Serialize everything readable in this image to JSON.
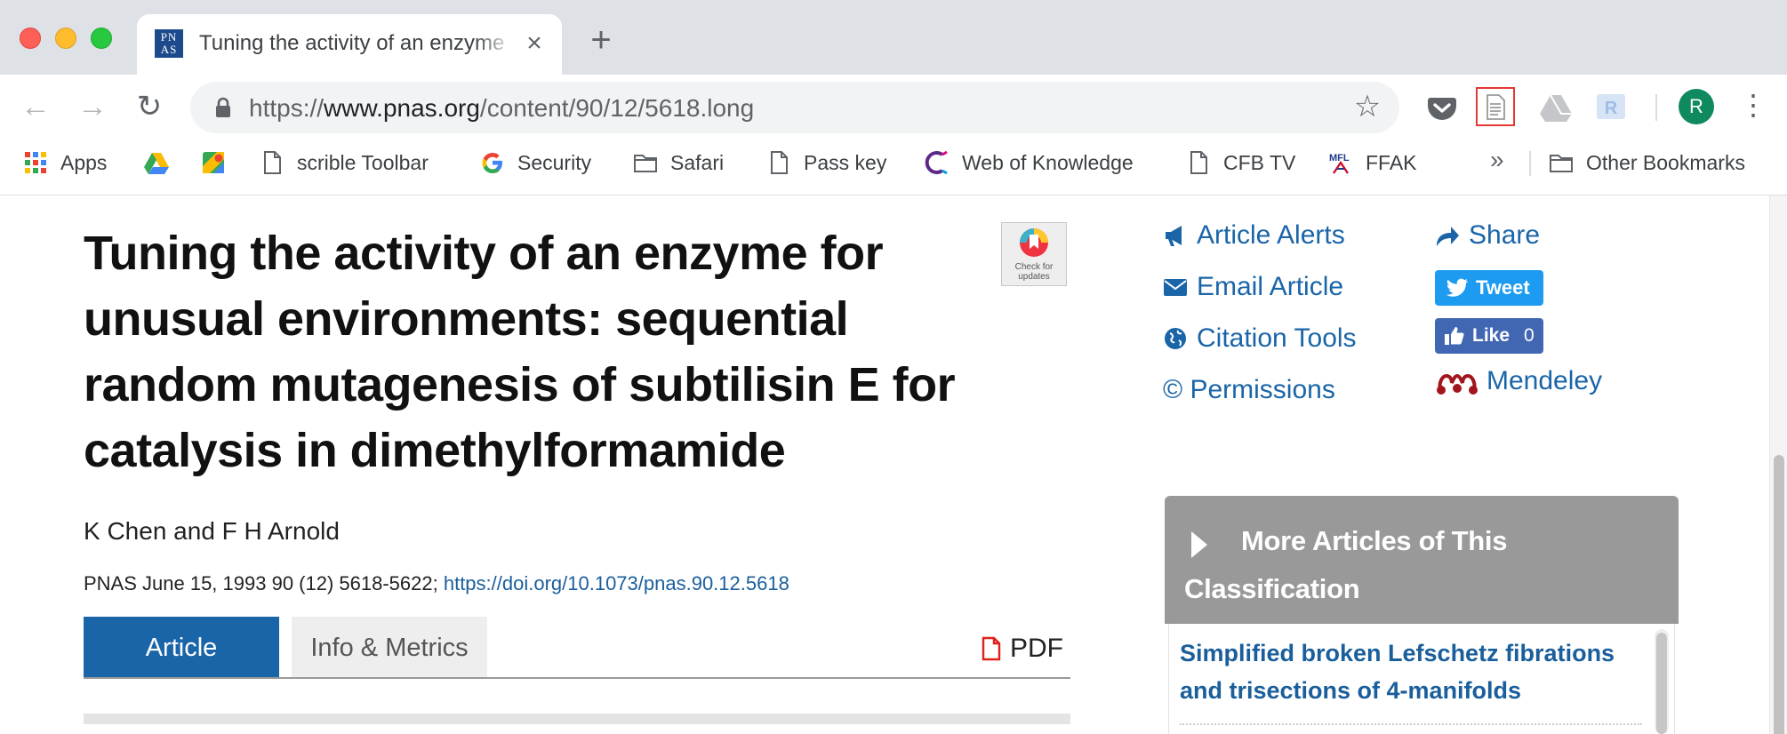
{
  "browser": {
    "tab": {
      "favicon_text": "PN AS",
      "title": "Tuning the activity of an enzyme for unusual environments"
    },
    "url": {
      "scheme": "https://",
      "host": "www.pnas.org",
      "path": "/content/90/12/5618.long"
    },
    "profile_initial": "R",
    "extensions": [
      "pocket-icon",
      "reader-view-icon",
      "drive-icon",
      "r-extension-icon"
    ]
  },
  "bookmarks": {
    "items": [
      {
        "label": "Apps",
        "icon": "apps-grid-icon"
      },
      {
        "label": "",
        "icon": "google-drive-icon"
      },
      {
        "label": "",
        "icon": "google-maps-icon"
      },
      {
        "label": "scrible Toolbar",
        "icon": "page-icon"
      },
      {
        "label": "Security",
        "icon": "google-g-icon"
      },
      {
        "label": "Safari",
        "icon": "folder-icon"
      },
      {
        "label": "Pass key",
        "icon": "page-icon"
      },
      {
        "label": "Web of Knowledge",
        "icon": "clarivate-icon"
      },
      {
        "label": "CFB TV",
        "icon": "page-icon"
      },
      {
        "label": "FFAK",
        "icon": "mfl-icon"
      }
    ],
    "more": "»",
    "other": "Other Bookmarks"
  },
  "article": {
    "title": "Tuning the activity of an enzyme for unusual environments: sequential random mutagenesis of subtilisin E for catalysis in dimethylformamide",
    "crossmark_label": "Check for updates",
    "authors": "K Chen and F H Arnold",
    "citation_text": "PNAS June 15, 1993 90 (12) 5618-5622; ",
    "doi": "https://doi.org/10.1073/pnas.90.12.5618",
    "tabs": {
      "article": "Article",
      "info": "Info & Metrics",
      "pdf": "PDF"
    }
  },
  "tools": {
    "article_alerts": "Article Alerts",
    "email_article": "Email Article",
    "citation_tools": "Citation Tools",
    "permissions": "© Permissions",
    "share": "Share",
    "tweet": "Tweet",
    "like": "Like",
    "like_count": "0",
    "mendeley": "Mendeley"
  },
  "more_articles": {
    "title": "More Articles of This Classification",
    "items": [
      "Simplified broken Lefschetz fibrations and trisections of 4-manifolds"
    ]
  },
  "colors": {
    "accent": "#1a65a8",
    "link": "#1a5e9c",
    "panel": "#999999",
    "highlight_box": "#e53935"
  }
}
